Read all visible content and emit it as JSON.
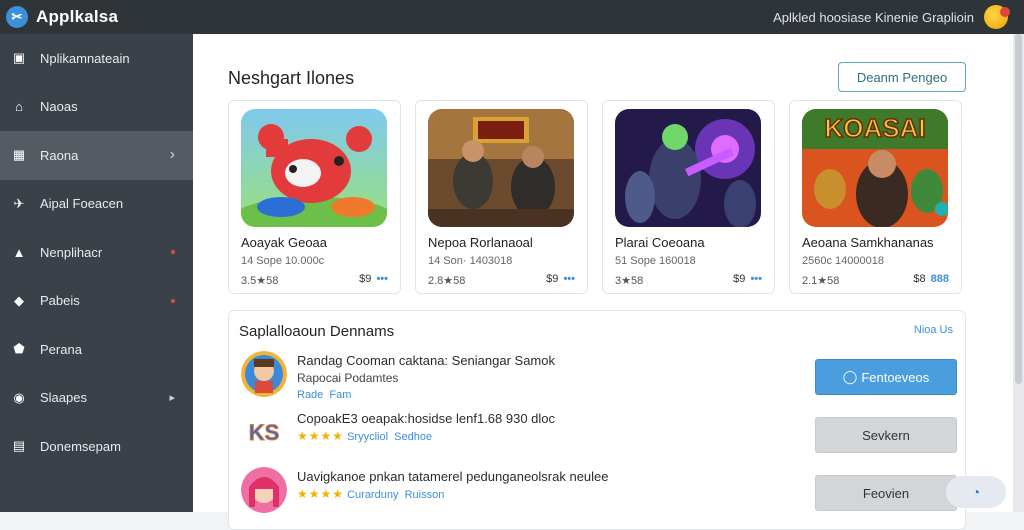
{
  "app": {
    "title": "Applkalsa",
    "logo_icon": "scissors-icon"
  },
  "topbar": {
    "link_text": "Aplkled hoosiase Kinenie Graplioin",
    "avatar_icon": "avatar-icon"
  },
  "sidebar": {
    "items": [
      {
        "label": "Nplikamnateain",
        "icon": "square-check-icon",
        "glyph": "▣",
        "active": false,
        "indicator": "none"
      },
      {
        "label": "Naoas",
        "icon": "home-icon",
        "glyph": "⌂",
        "active": false,
        "indicator": "none"
      },
      {
        "label": "Raona",
        "icon": "grid-icon",
        "glyph": "▦",
        "active": true,
        "indicator": "arrow"
      },
      {
        "label": "Aipal Foeacen",
        "icon": "bird-icon",
        "glyph": "✈",
        "active": false,
        "indicator": "none"
      },
      {
        "label": "Nenplihacr",
        "icon": "chart-icon",
        "glyph": "▲",
        "active": false,
        "indicator": "dot"
      },
      {
        "label": "Pabeis",
        "icon": "shield-icon",
        "glyph": "◆",
        "active": false,
        "indicator": "dot"
      },
      {
        "label": "Perana",
        "icon": "tag-icon",
        "glyph": "⬟",
        "active": false,
        "indicator": "none"
      },
      {
        "label": "Slaapes",
        "icon": "target-icon",
        "glyph": "◉",
        "active": false,
        "indicator": "arrow-small"
      },
      {
        "label": "Donemsepam",
        "icon": "calendar-icon",
        "glyph": "▤",
        "active": false,
        "indicator": "none"
      }
    ]
  },
  "main": {
    "section_title": "Neshgart Ilones",
    "header_button": "Deanm Pengeo",
    "cards": [
      {
        "name": "Aoayak Geoaa",
        "meta": "14 Sope 10.000c",
        "rating": "3.5★58",
        "price": "$9",
        "dots": "•••",
        "art": "controller"
      },
      {
        "name": "Nepoa Rorlanaoal",
        "meta": "14 Son· 1403018",
        "rating": "2.8★58",
        "price": "$9",
        "dots": "•••",
        "art": "soldiers"
      },
      {
        "name": "Plarai Coeoana",
        "meta": "51 Sope 160018",
        "rating": "3★58",
        "price": "$9",
        "dots": "•••",
        "art": "fighters"
      },
      {
        "name": "Aeoana Samkhananas",
        "meta": "2560c 14000018",
        "rating": "2.1★58",
        "price": "$8",
        "dots": "888",
        "art": "koasai"
      }
    ],
    "panel": {
      "title": "Saplalloaoun Dennams",
      "link": "Nioa Us",
      "rows": [
        {
          "line1": "Randag Cooman caktana: Seniangar Samok",
          "line2": "Rapocai Podamtes",
          "line3_a": "Rade",
          "line3_b": "Fam",
          "stars": "",
          "button": "Fentoeveos",
          "button_style": "primary",
          "icon": "game-avatar-icon"
        },
        {
          "line1": "CopoakE3 oeapak:hosidse lenf1.68 930 dloc",
          "line2": "",
          "line3_a": "Sryycliol",
          "line3_b": "Sedhoe",
          "stars": "★★★★",
          "button": "Sevkern",
          "button_style": "grey",
          "icon": "ks-logo-icon"
        },
        {
          "line1": "Uavigkanoe pnkan tatamerel pedunganeolsrak neulee",
          "line2": "",
          "line3_a": "Curarduny",
          "line3_b": "Ruisson",
          "stars": "★★★★",
          "button": "Feovien",
          "button_style": "grey",
          "icon": "girl-avatar-icon"
        }
      ]
    }
  }
}
